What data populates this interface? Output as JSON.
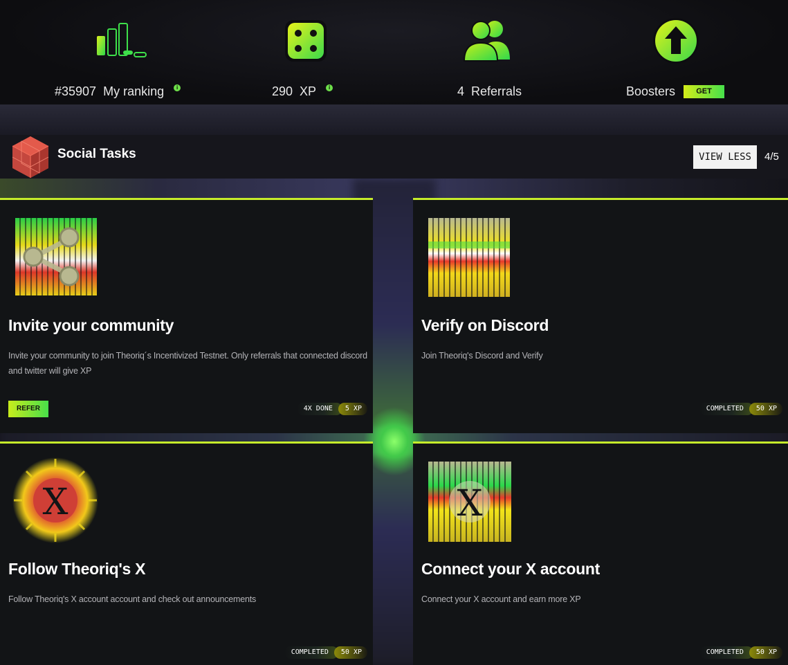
{
  "stats": {
    "ranking": {
      "value": "#35907",
      "label": "My ranking",
      "info": "i"
    },
    "xp": {
      "value": "290",
      "label": "XP",
      "info": "i"
    },
    "referrals": {
      "value": "4",
      "label": "Referrals"
    },
    "boosters": {
      "label": "Boosters",
      "button": "GET"
    }
  },
  "section": {
    "title": "Social Tasks",
    "view_less": "VIEW LESS",
    "progress": "4/5"
  },
  "tasks": [
    {
      "title": "Invite your community",
      "description": "Invite your community to join Theoriq´s Incentivized Testnet. Only referrals that connected discord and twitter will give XP",
      "action": "REFER",
      "status": "4X DONE",
      "xp": "5 XP",
      "icon": "share-icon"
    },
    {
      "title": "Verify on Discord",
      "description": "Join Theoriq's Discord and Verify",
      "status": "COMPLETED",
      "xp": "50 XP",
      "icon": "discord-glitch-icon"
    },
    {
      "title": "Follow Theoriq's X",
      "description": "Follow Theoriq's X account account and check out announcements",
      "status": "COMPLETED",
      "xp": "50 XP",
      "icon": "x-logo-icon"
    },
    {
      "title": "Connect your X account",
      "description": "Connect your X account and earn more XP",
      "status": "COMPLETED",
      "xp": "50 XP",
      "icon": "x-logo-icon"
    }
  ],
  "colors": {
    "accent_lime": "#c6ec2a",
    "accent_green": "#46e04b",
    "background": "#0c0c0e",
    "card": "#121416"
  }
}
